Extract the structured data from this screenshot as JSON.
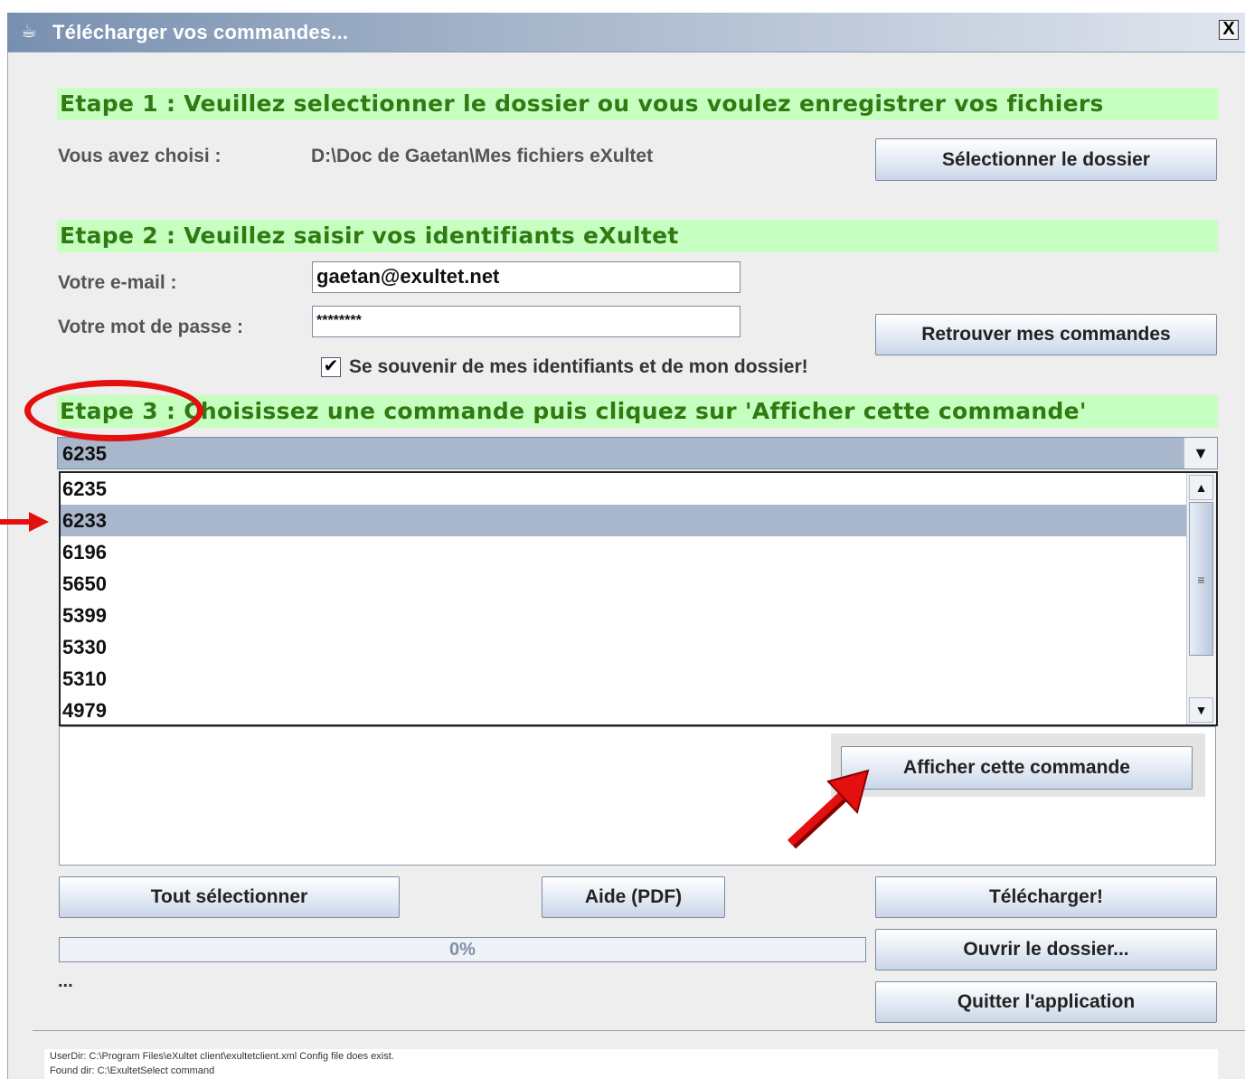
{
  "window": {
    "title": "Télécharger vos commandes...",
    "close_label": "X"
  },
  "step1": {
    "heading": "Etape 1 : Veuillez selectionner le dossier ou vous voulez enregistrer vos fichiers",
    "chosen_label": "Vous avez choisi :",
    "chosen_path": "D:\\Doc de Gaetan\\Mes fichiers eXultet",
    "select_button": "Sélectionner le dossier"
  },
  "step2": {
    "heading": "Etape 2 : Veuillez saisir vos identifiants eXultet",
    "email_label": "Votre e-mail :",
    "email_value": "gaetan@exultet.net",
    "password_label": "Votre mot de passe :",
    "password_value": "********",
    "remember_label": "Se souvenir de mes identifiants et de mon dossier!",
    "remember_checked": true,
    "find_button": "Retrouver mes commandes"
  },
  "step3": {
    "heading": "Etape 3 : Choisissez une commande puis cliquez sur 'Afficher cette commande'",
    "selected_order": "6235",
    "orders": [
      "6235",
      "6233",
      "6196",
      "5650",
      "5399",
      "5330",
      "5310",
      "4979"
    ],
    "highlighted_index": 1,
    "show_button": "Afficher cette commande"
  },
  "footer": {
    "select_all_button": "Tout sélectionner",
    "help_button": "Aide (PDF)",
    "download_button": "Télécharger!",
    "open_folder_button": "Ouvrir le dossier...",
    "quit_button": "Quitter l'application",
    "progress_text": "0%",
    "progress_value": 0,
    "status_text": "...",
    "log_line1": "UserDir: C:\\Program Files\\eXultet client\\exultetclient.xml Config file does exist.",
    "log_line2": "Found dir: C:\\ExultetSelect command"
  },
  "colors": {
    "step_bg": "#c6ffc0",
    "step_text": "#2f7a12",
    "selection": "#a9b7cc",
    "annotation": "#e41010"
  }
}
